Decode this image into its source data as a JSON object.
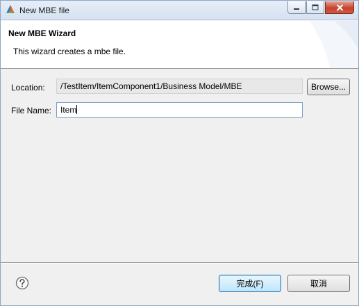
{
  "window": {
    "title": "New MBE file"
  },
  "banner": {
    "title": "New MBE Wizard",
    "description": "This wizard creates a mbe file."
  },
  "form": {
    "location_label": "Location:",
    "location_value": "/TestItem/ItemComponent1/Business Model/MBE",
    "browse_label": "Browse...",
    "filename_label": "File Name:",
    "filename_value": "Item"
  },
  "footer": {
    "finish_label": "完成(F)",
    "cancel_label": "取消"
  },
  "icons": {
    "app": "eclipse-app-icon",
    "minimize": "minimize-icon",
    "maximize": "maximize-icon",
    "close": "close-icon",
    "help": "help-icon"
  },
  "colors": {
    "default_button_border": "#3c7fb1",
    "close_button": "#c6432f",
    "banner_background": "#ffffff",
    "dialog_background": "#f0f0f0"
  }
}
